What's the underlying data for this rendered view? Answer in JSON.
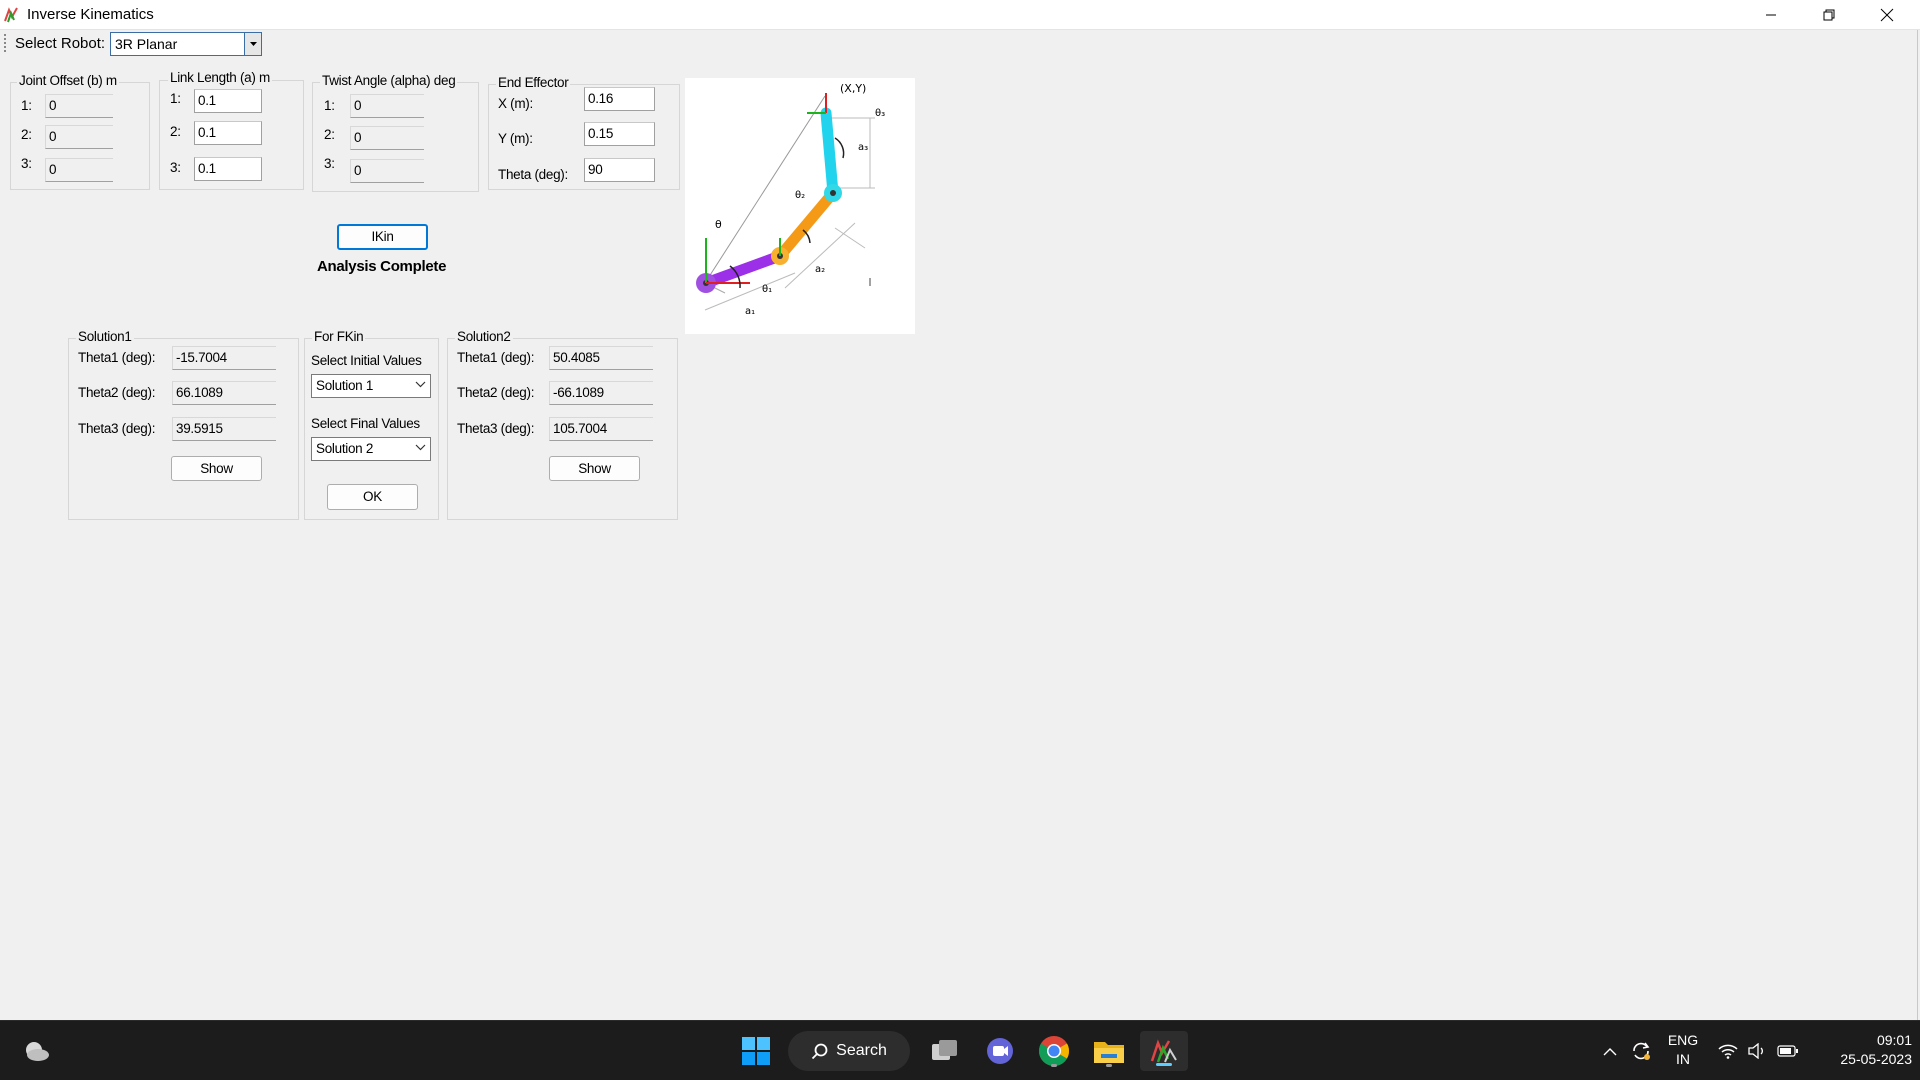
{
  "window": {
    "title": "Inverse Kinematics",
    "minimize_icon": "minimize-icon",
    "maximize_icon": "restore-icon",
    "close_icon": "close-icon"
  },
  "toolbar": {
    "select_robot_label": "Select Robot:",
    "robot_value": "3R Planar"
  },
  "joint_offset": {
    "title": "Joint Offset (b) m",
    "rows": [
      {
        "label": "1:",
        "value": "0"
      },
      {
        "label": "2:",
        "value": "0"
      },
      {
        "label": "3:",
        "value": "0"
      }
    ]
  },
  "link_length": {
    "title": "Link Length (a) m",
    "rows": [
      {
        "label": "1:",
        "value": "0.1"
      },
      {
        "label": "2:",
        "value": "0.1"
      },
      {
        "label": "3:",
        "value": "0.1"
      }
    ]
  },
  "twist_angle": {
    "title": "Twist Angle (alpha) deg",
    "rows": [
      {
        "label": "1:",
        "value": "0"
      },
      {
        "label": "2:",
        "value": "0"
      },
      {
        "label": "3:",
        "value": "0"
      }
    ]
  },
  "end_effector": {
    "title": "End Effector",
    "x_label": "X (m):",
    "x_value": "0.16",
    "y_label": "Y (m):",
    "y_value": "0.15",
    "theta_label": "Theta (deg):",
    "theta_value": "90"
  },
  "ikin_button": "IKin",
  "status_text": "Analysis Complete",
  "diagram": {
    "labels": {
      "xy": "(X,Y)",
      "theta": "θ",
      "theta1": "θ₁",
      "theta2": "θ₂",
      "theta3": "θ₃",
      "a1": "a₁",
      "a2": "a₂",
      "a3": "a₃"
    },
    "colors": {
      "link1": "#9b30e8",
      "link2": "#f59a16",
      "link3": "#22d3ee",
      "base": "#a050e0"
    }
  },
  "solution1": {
    "title": "Solution1",
    "theta1_label": "Theta1 (deg):",
    "theta1_value": "-15.7004",
    "theta2_label": "Theta2 (deg):",
    "theta2_value": "66.1089",
    "theta3_label": "Theta3 (deg):",
    "theta3_value": "39.5915",
    "show_button": "Show"
  },
  "fkin": {
    "title": "For FKin",
    "initial_label": "Select Initial Values",
    "initial_value": "Solution 1",
    "final_label": "Select Final Values",
    "final_value": "Solution 2",
    "ok_button": "OK"
  },
  "solution2": {
    "title": "Solution2",
    "theta1_label": "Theta1 (deg):",
    "theta1_value": "50.4085",
    "theta2_label": "Theta2 (deg):",
    "theta2_value": "-66.1089",
    "theta3_label": "Theta3 (deg):",
    "theta3_value": "105.7004",
    "show_button": "Show"
  },
  "taskbar": {
    "search_label": "Search",
    "language_line1": "ENG",
    "language_line2": "IN",
    "time": "09:01",
    "date": "25-05-2023",
    "icons": [
      "weather-icon",
      "windows-start-icon",
      "search-icon",
      "task-view-icon",
      "teams-chat-icon",
      "chrome-icon",
      "file-explorer-icon",
      "robo-app-icon",
      "chevron-up-icon",
      "sync-icon",
      "wifi-icon",
      "volume-icon",
      "battery-icon"
    ],
    "accent_color": "#60cdff"
  }
}
